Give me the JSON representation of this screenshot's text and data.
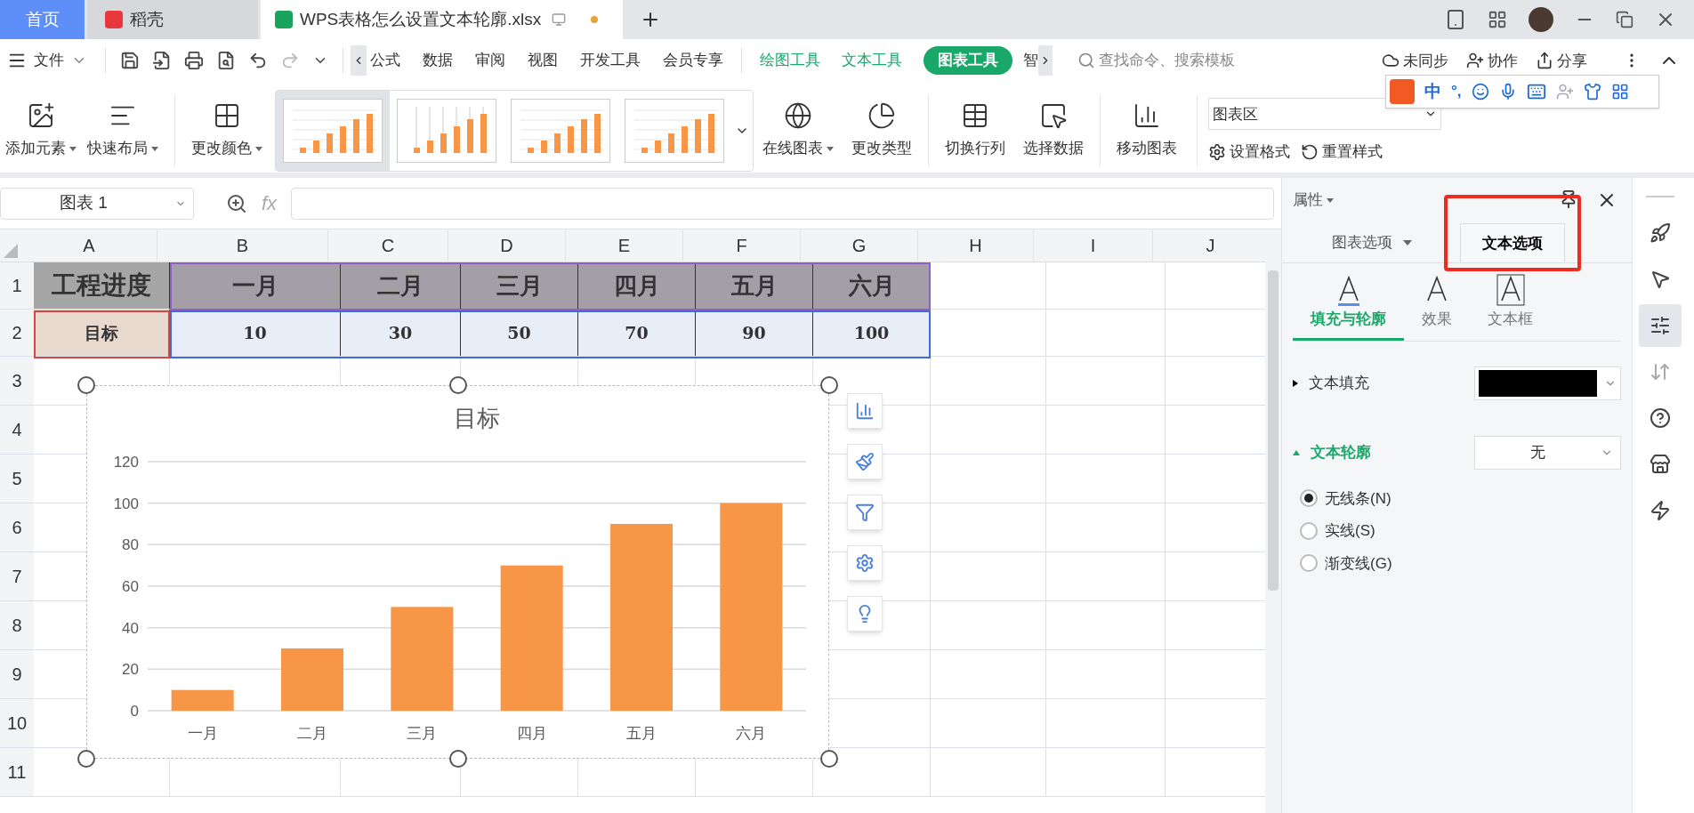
{
  "tabs": [
    {
      "label": "首页",
      "selected": false,
      "kind": "home"
    },
    {
      "label": "稻壳",
      "selected": false,
      "kind": "docer"
    },
    {
      "label": "WPS表格怎么设置文本轮廓.xlsx",
      "selected": true,
      "kind": "sheet",
      "unsaved": true
    }
  ],
  "menu": {
    "file": "文件",
    "items": [
      "公式",
      "数据",
      "审阅",
      "视图",
      "开发工具",
      "会员专享"
    ],
    "context_tabs": [
      {
        "label": "绘图工具",
        "selected": false
      },
      {
        "label": "文本工具",
        "selected": false
      },
      {
        "label": "图表工具",
        "selected": true
      }
    ],
    "cut_item": "智",
    "search": {
      "placeholder": "查找命令、搜索模板"
    },
    "sync": "未同步",
    "collab": "协作",
    "share": "分享"
  },
  "ime": {
    "mode": "中",
    "punct": "°,"
  },
  "ribbon": {
    "left": [
      {
        "label": "添加元素",
        "dropdown": true,
        "kind": "add"
      },
      {
        "label": "快速布局",
        "dropdown": true,
        "kind": "layout"
      },
      {
        "label": "更改颜色",
        "dropdown": true,
        "kind": "color"
      }
    ],
    "styles": [
      {
        "selected": true
      },
      {
        "selected": false
      },
      {
        "selected": false
      },
      {
        "selected": false
      }
    ],
    "right": [
      {
        "label": "在线图表",
        "dropdown": true,
        "kind": "online"
      },
      {
        "label": "更改类型",
        "dropdown": false,
        "kind": "type"
      },
      {
        "label": "切换行列",
        "dropdown": false,
        "kind": "switch"
      },
      {
        "label": "选择数据",
        "dropdown": false,
        "kind": "select"
      },
      {
        "label": "移动图表",
        "dropdown": false,
        "kind": "move"
      }
    ],
    "element": "图表区",
    "format": "设置格式",
    "reset": "重置样式"
  },
  "formula_bar": {
    "name": "图表 1",
    "fx": "fx"
  },
  "sheet": {
    "columns": [
      "A",
      "B",
      "C",
      "D",
      "E",
      "F",
      "G",
      "H",
      "I",
      "J"
    ],
    "rows": [
      {
        "header": "1",
        "kind": "title",
        "cells": [
          "工程进度",
          "一月",
          "二月",
          "三月",
          "四月",
          "五月",
          "六月"
        ]
      },
      {
        "header": "2",
        "kind": "value",
        "cells": [
          "目标",
          "10",
          "30",
          "50",
          "70",
          "90",
          "100"
        ]
      },
      {
        "header": "3",
        "kind": "empty"
      },
      {
        "header": "4",
        "kind": "empty"
      },
      {
        "header": "5",
        "kind": "empty"
      },
      {
        "header": "6",
        "kind": "empty"
      },
      {
        "header": "7",
        "kind": "empty"
      },
      {
        "header": "8",
        "kind": "empty"
      },
      {
        "header": "9",
        "kind": "empty"
      },
      {
        "header": "10",
        "kind": "empty"
      },
      {
        "header": "11",
        "kind": "empty"
      }
    ]
  },
  "chart": {
    "chart_data": {
      "type": "bar",
      "title": "目标",
      "categories": [
        "一月",
        "二月",
        "三月",
        "四月",
        "五月",
        "六月"
      ],
      "series": [
        {
          "color": "#f79646",
          "values": [
            10,
            30,
            50,
            70,
            90,
            100
          ]
        }
      ],
      "ylim": [
        0,
        120
      ],
      "yticks": [
        0,
        20,
        40,
        60,
        80,
        100,
        120
      ],
      "grid": true
    }
  },
  "panel": {
    "title": "属性",
    "tabs": [
      {
        "label": "图表选项",
        "selected": false,
        "dropdown": true,
        "highlighted": false
      },
      {
        "label": "文本选项",
        "selected": true,
        "dropdown": false,
        "highlighted": true
      }
    ],
    "subtabs": [
      {
        "label": "填充与轮廓",
        "selected": true,
        "kind": "fill"
      },
      {
        "label": "效果",
        "selected": false,
        "kind": "effect"
      },
      {
        "label": "文本框",
        "selected": false,
        "kind": "textbox"
      }
    ],
    "fill": {
      "label": "文本填充",
      "expanded": false,
      "color": "#000000"
    },
    "outline": {
      "label": "文本轮廓",
      "expanded": true,
      "value": "无"
    },
    "radios": [
      {
        "label": "无线条(N)",
        "selected": true
      },
      {
        "label": "实线(S)",
        "selected": false
      },
      {
        "label": "渐变线(G)",
        "selected": false
      }
    ]
  }
}
